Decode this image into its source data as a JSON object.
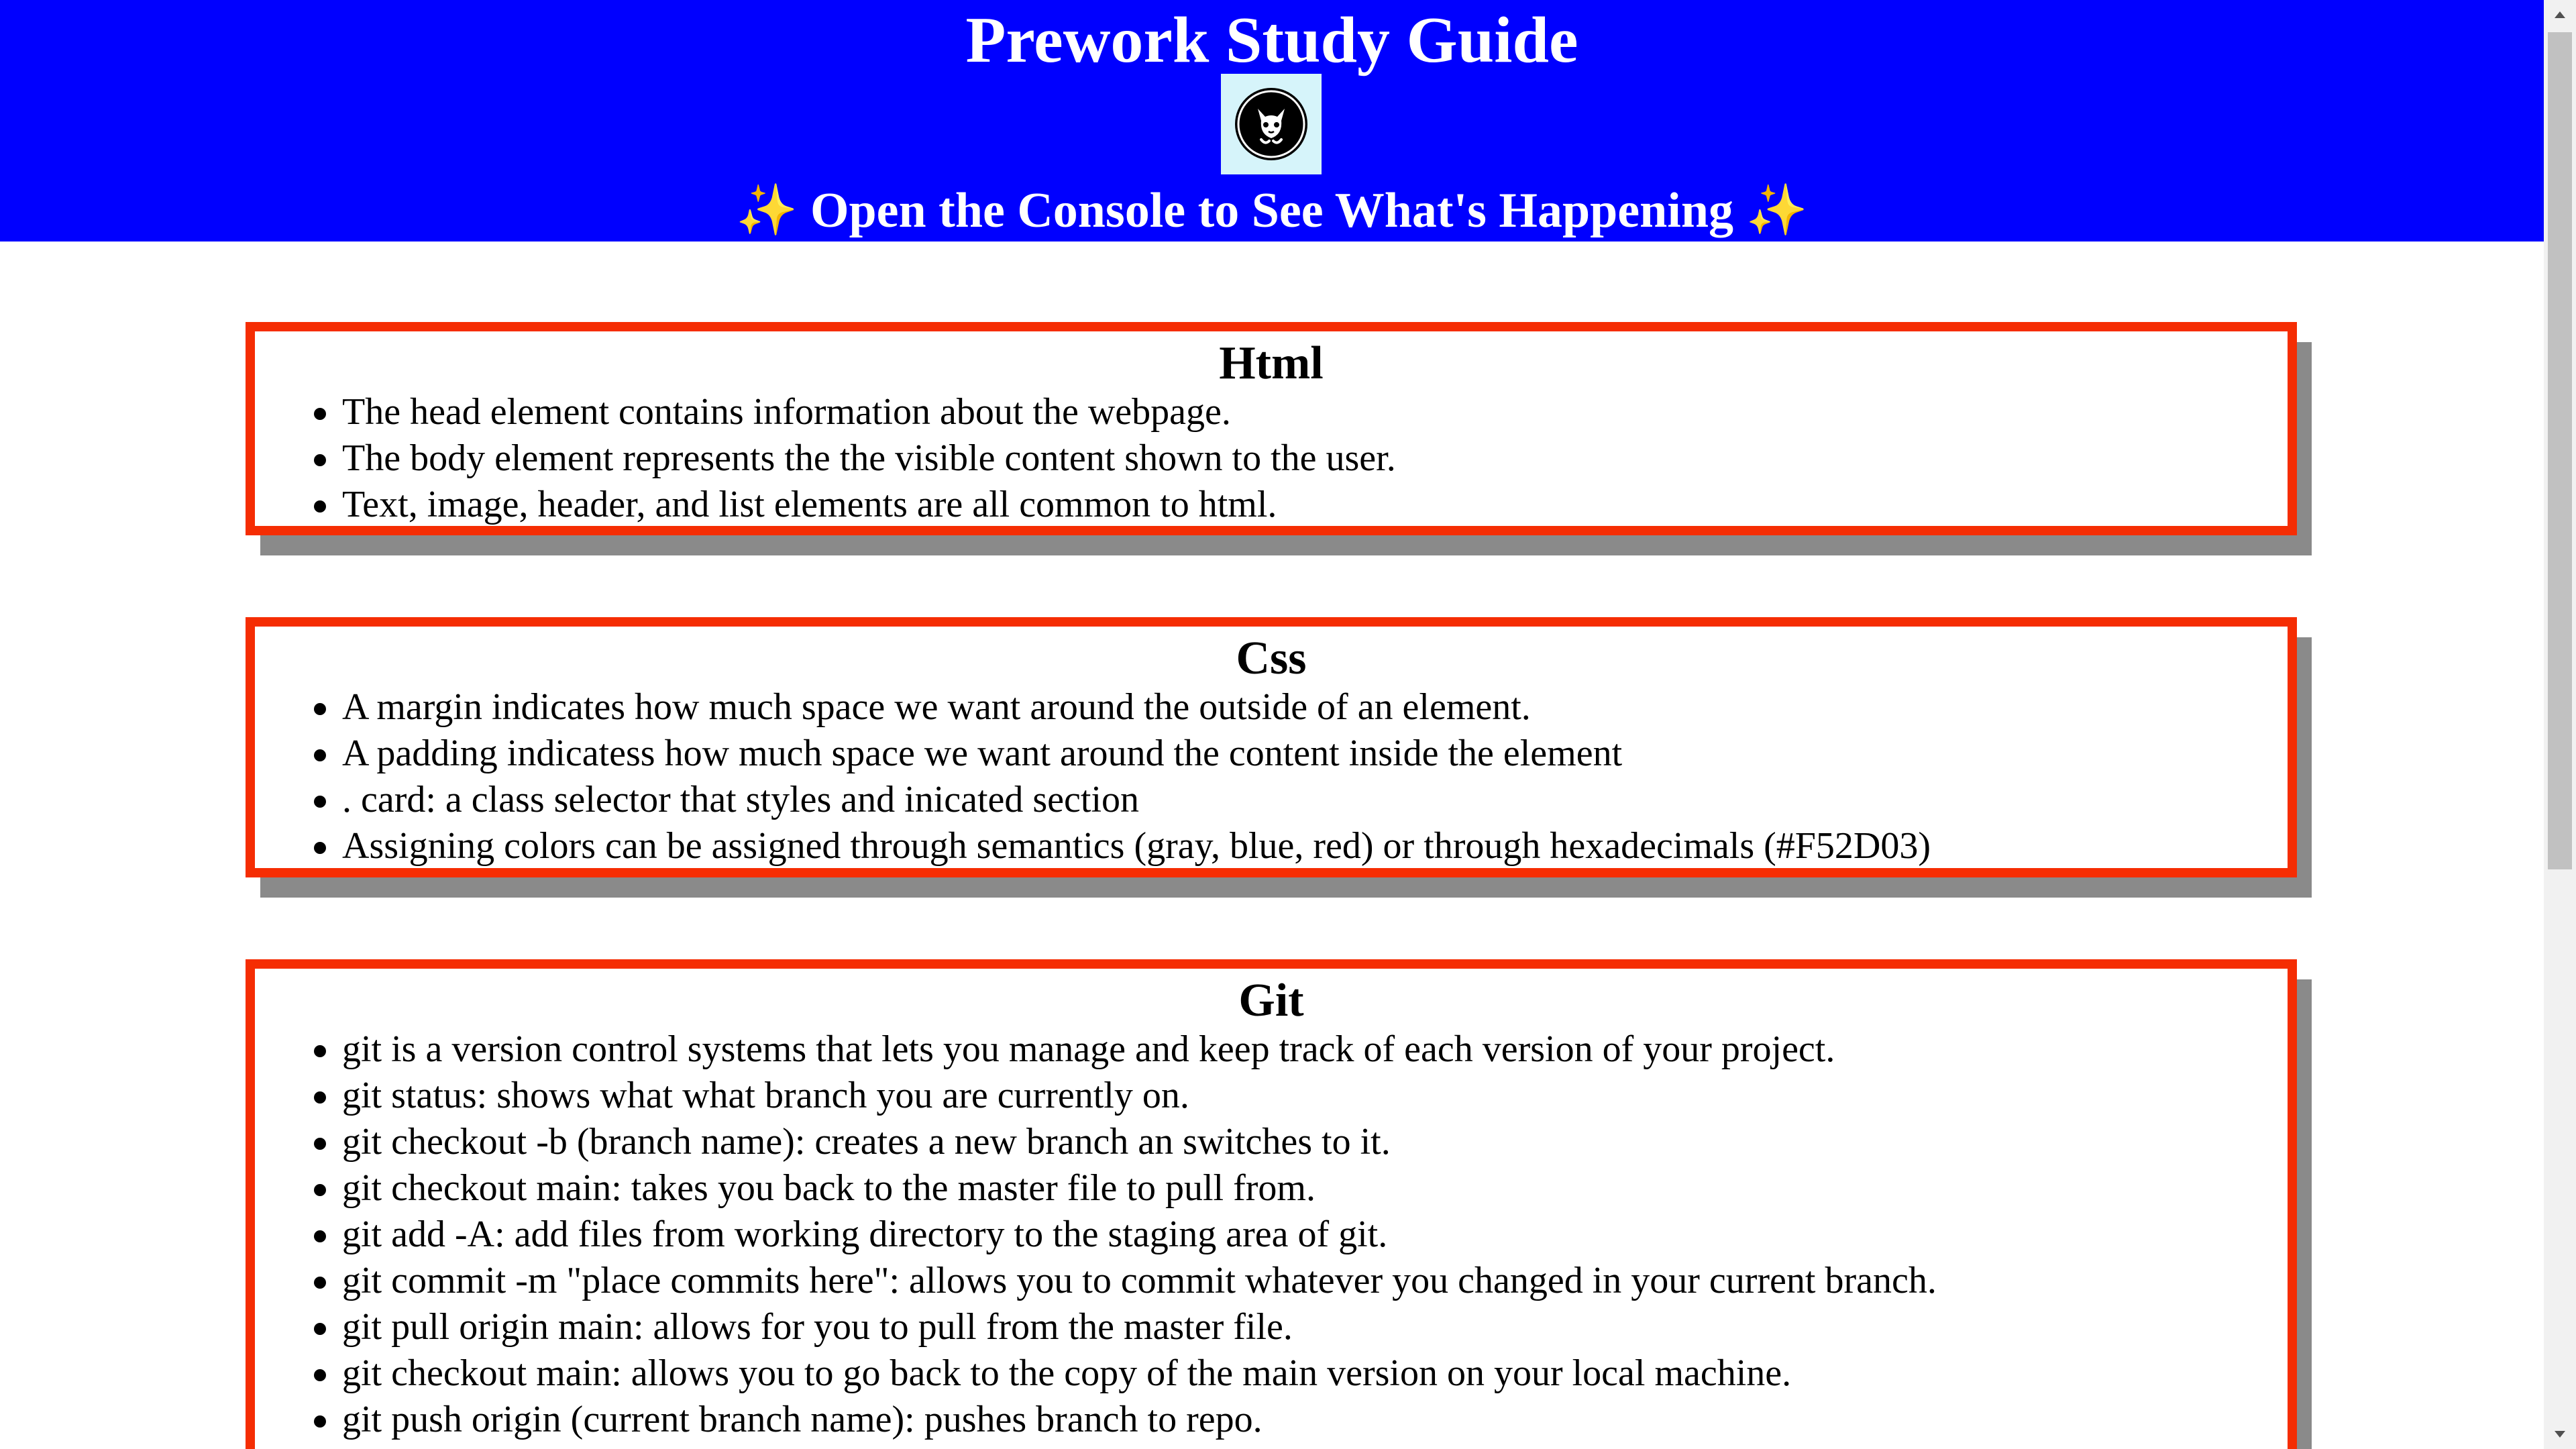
{
  "header": {
    "title": "Prework Study Guide",
    "subtitle": "Open the Console to See What's Happening",
    "sparkle": "✨",
    "background_color": "#0000ff",
    "logo_icon": "cat-logo-icon"
  },
  "cards": {
    "border_color": "#F52D03",
    "html": {
      "heading": "Html",
      "items": [
        "The head element contains information about the webpage.",
        "The body element represents the the visible content shown to the user.",
        "Text, image, header, and list elements are all common to html."
      ]
    },
    "css": {
      "heading": "Css",
      "items": [
        "A margin indicates how much space we want around the outside of an element.",
        "A padding indicatess how much space we want around the content inside the element",
        ". card: a class selector that styles and inicated section",
        "Assigning colors can be assigned through semantics (gray, blue, red) or through hexadecimals (#F52D03)"
      ]
    },
    "git": {
      "heading": "Git",
      "items": [
        "git is a version control systems that lets you manage and keep track of each version of your project.",
        "git status: shows what what branch you are currently on.",
        "git checkout -b (branch name): creates a new branch an switches to it.",
        "git checkout main: takes you back to the master file to pull from.",
        "git add -A: add files from working directory to the staging area of git.",
        "git commit -m \"place commits here\": allows you to commit whatever you changed in your current branch.",
        "git pull origin main: allows for you to pull from the master file.",
        "git checkout main: allows you to go back to the copy of the main version on your local machine.",
        "git push origin (current branch name): pushes branch to repo."
      ]
    }
  }
}
